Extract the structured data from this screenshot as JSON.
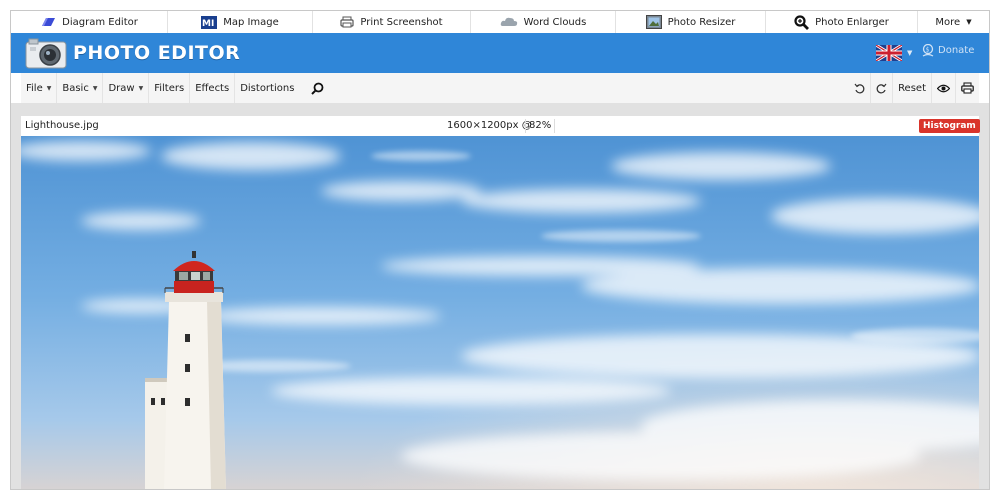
{
  "apps": [
    {
      "label": "Diagram Editor",
      "icon": "diagram-eraser-icon"
    },
    {
      "label": "Map Image",
      "icon": "map-image-icon"
    },
    {
      "label": "Print Screenshot",
      "icon": "printer-icon"
    },
    {
      "label": "Word Clouds",
      "icon": "cloud-icon"
    },
    {
      "label": "Photo Resizer",
      "icon": "photo-frame-icon"
    },
    {
      "label": "Photo Enlarger",
      "icon": "magnifier-icon"
    },
    {
      "label": "More",
      "icon": "chevron-down-icon"
    }
  ],
  "header": {
    "logo_text": "PHOTO EDITOR",
    "donate_label": "Donate",
    "language_flag": "uk-flag-icon"
  },
  "toolbar": {
    "menus": [
      {
        "label": "File",
        "has_caret": true
      },
      {
        "label": "Basic",
        "has_caret": true
      },
      {
        "label": "Draw",
        "has_caret": true
      },
      {
        "label": "Filters",
        "has_caret": false
      },
      {
        "label": "Effects",
        "has_caret": false
      },
      {
        "label": "Distortions",
        "has_caret": false
      }
    ],
    "reset_label": "Reset"
  },
  "image_info": {
    "filename": "Lighthouse.jpg",
    "dimensions": "1600×1200px @",
    "zoom": "82%",
    "histogram_label": "Histogram"
  },
  "colors": {
    "header_blue": "#2f86d8",
    "histogram_red": "#d9342b",
    "workspace_gray": "#e1e1e1"
  }
}
